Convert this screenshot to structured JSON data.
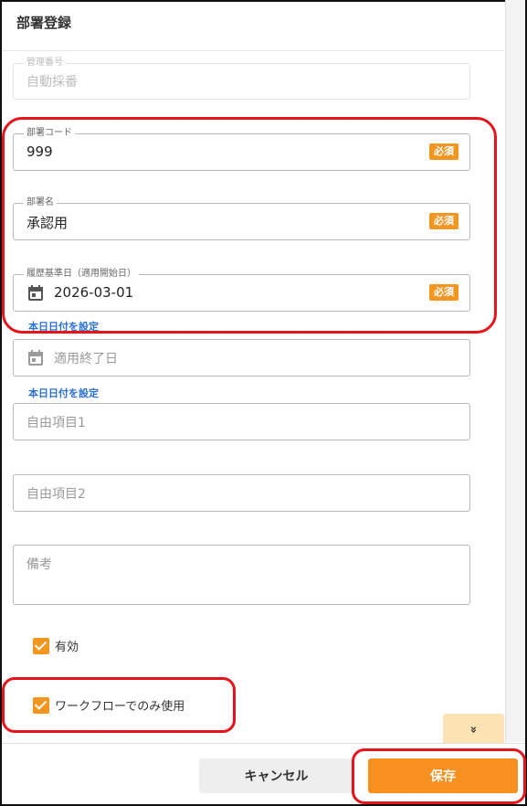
{
  "dialog": {
    "title": "部署登録"
  },
  "fields": {
    "management_no": {
      "label": "管理番号",
      "value": "自動採番"
    },
    "dept_code": {
      "label": "部署コード",
      "value": "999",
      "required": "必須"
    },
    "dept_name": {
      "label": "部署名",
      "value": "承認用",
      "required": "必須"
    },
    "history_date": {
      "label": "履歴基準日（適用開始日）",
      "value": "2026-03-01",
      "required": "必須"
    },
    "end_date": {
      "placeholder": "適用終了日"
    },
    "free1": {
      "placeholder": "自由項目1"
    },
    "free2": {
      "placeholder": "自由項目2"
    },
    "remarks": {
      "placeholder": "備考"
    }
  },
  "links": {
    "set_today_1": "本日日付を設定",
    "set_today_2": "本日日付を設定"
  },
  "checkboxes": {
    "valid": {
      "label": "有効",
      "checked": true
    },
    "workflow_only": {
      "label": "ワークフローでのみ使用",
      "checked": true
    }
  },
  "expand": {
    "icon": "double-chevron-down-icon",
    "glyph": "»"
  },
  "footer": {
    "cancel_label": "キャンセル",
    "save_label": "保存"
  },
  "colors": {
    "accent": "#f39521",
    "highlight": "#e8141b",
    "link": "#2a6fd6"
  }
}
